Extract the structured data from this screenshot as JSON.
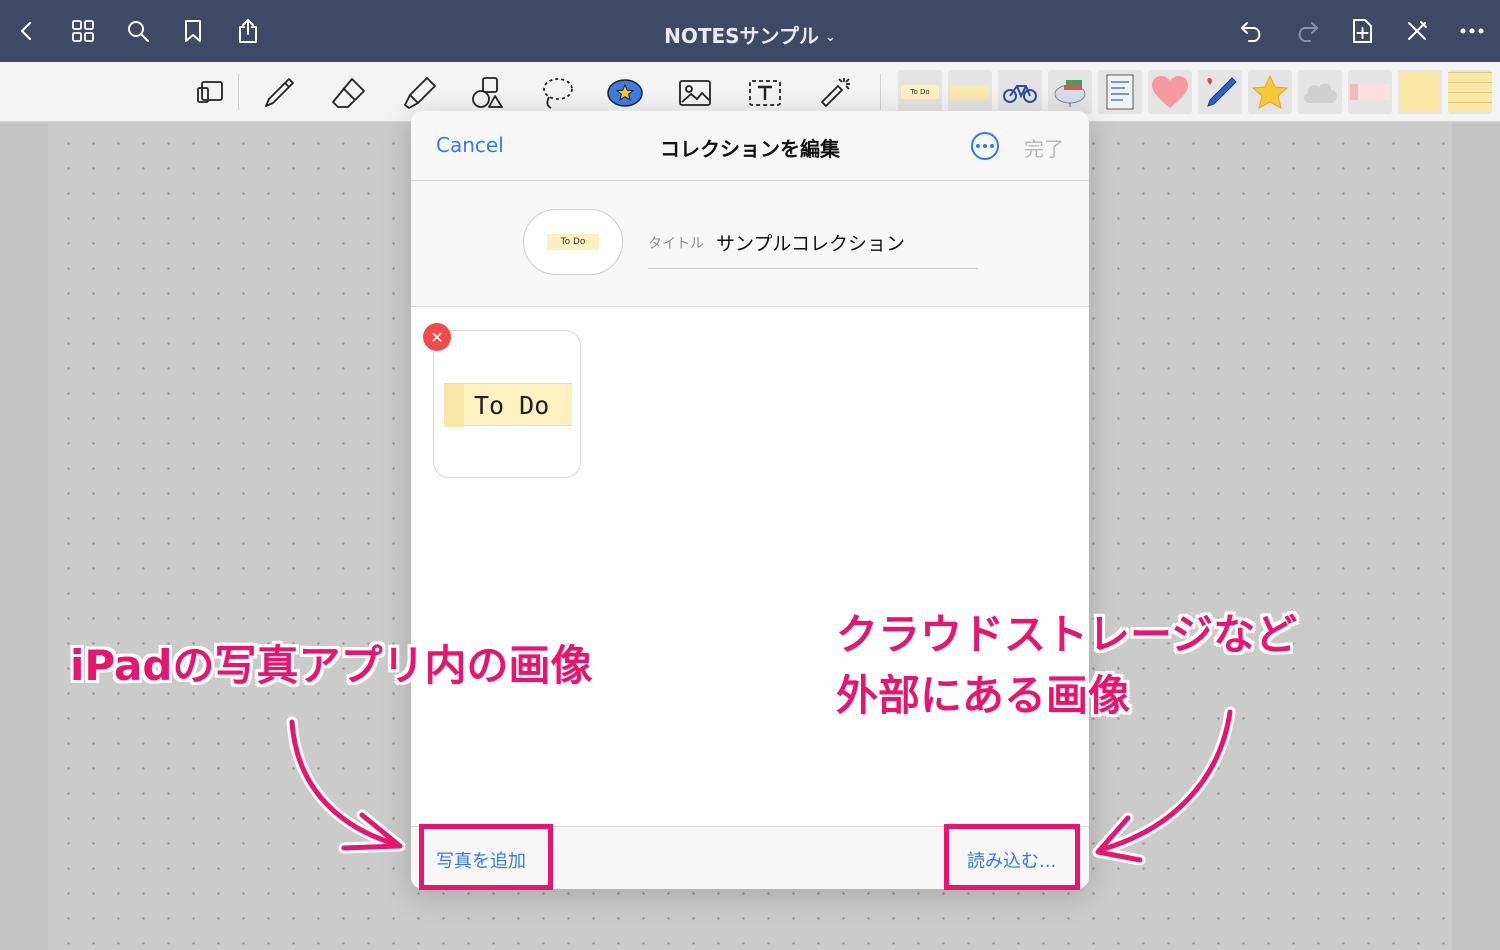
{
  "nav": {
    "title": "NOTESサンプル",
    "title_chevron": "⌄",
    "left_icons": [
      "back-icon",
      "grid-icon",
      "search-icon",
      "bookmark-icon",
      "share-icon"
    ],
    "right_icons": [
      "undo-icon",
      "redo-icon",
      "add-page-icon",
      "close-pen-icon",
      "more-icon"
    ]
  },
  "toolbar": {
    "tools": [
      "paper-tool-icon",
      "pen-icon",
      "eraser-icon",
      "highlighter-icon",
      "shapes-icon",
      "lasso-icon",
      "sticker-icon",
      "image-icon",
      "text-icon",
      "laser-pointer-icon"
    ],
    "stickers": [
      {
        "name": "todo-sticker",
        "label": "To Do"
      },
      {
        "name": "tape-sticker",
        "label": ""
      },
      {
        "name": "bicycle-sticker",
        "label": ""
      },
      {
        "name": "book-sticker",
        "label": ""
      },
      {
        "name": "note-sticker",
        "label": ""
      },
      {
        "name": "heart-sticker",
        "label": ""
      },
      {
        "name": "pen-sticker",
        "label": ""
      },
      {
        "name": "star-sticker",
        "label": ""
      },
      {
        "name": "cloud-sticker",
        "label": ""
      },
      {
        "name": "label-sticker",
        "label": ""
      },
      {
        "name": "yellow-note-sticker",
        "label": ""
      },
      {
        "name": "lined-note-sticker",
        "label": ""
      }
    ]
  },
  "modal": {
    "cancel_label": "Cancel",
    "title": "コレクションを編集",
    "done_label": "完了",
    "collection": {
      "thumbnail_label": "To Do",
      "title_label": "タイトル",
      "title_value": "サンプルコレクション"
    },
    "items": [
      {
        "label": "To Do"
      }
    ],
    "delete_symbol": "✕",
    "add_photo_label": "写真を追加",
    "import_label": "読み込む..."
  },
  "annotations": {
    "left_text": "iPadの写真アプリ内の画像",
    "right_line1": "クラウドストレージなど",
    "right_line2": "外部にある画像",
    "color": "#e8156d"
  },
  "colors": {
    "nav_bg": "#3e4a64",
    "accent": "#2f7bf6",
    "highlight": "#e8156d",
    "delete_badge": "#f04a4a"
  }
}
